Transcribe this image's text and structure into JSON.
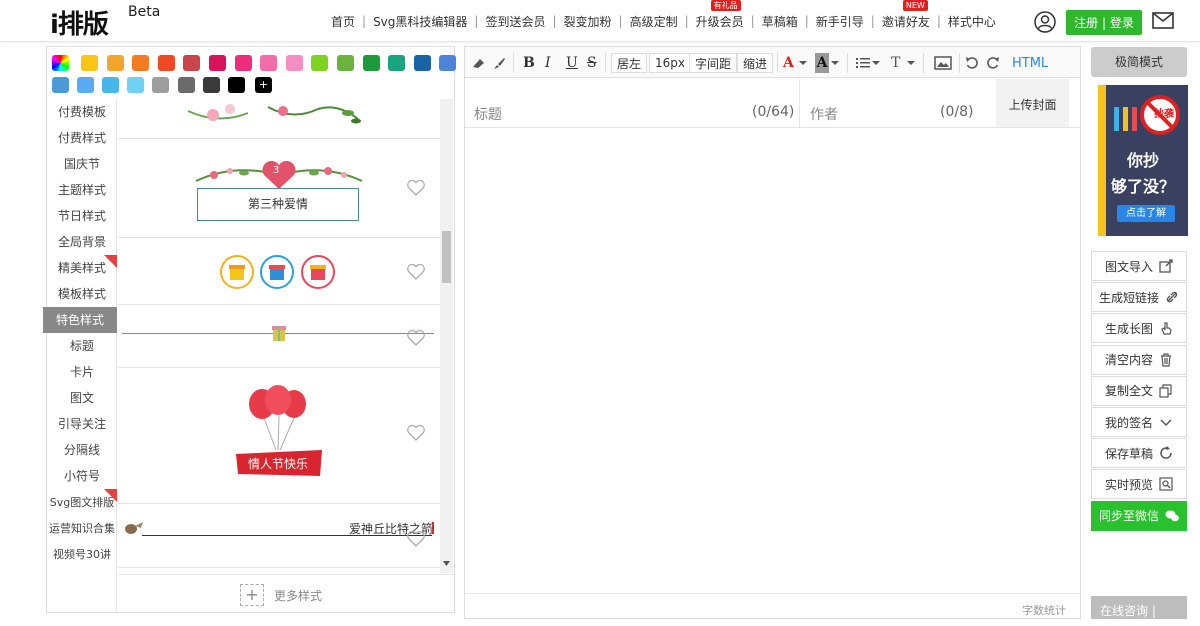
{
  "logo": {
    "main": "i排版",
    "beta": "Beta"
  },
  "nav": [
    {
      "label": "首页",
      "tag": ""
    },
    {
      "label": "Svg黑科技编辑器",
      "tag": ""
    },
    {
      "label": "签到送会员",
      "tag": ""
    },
    {
      "label": "裂变加粉",
      "tag": ""
    },
    {
      "label": "高级定制",
      "tag": ""
    },
    {
      "label": "升级会员",
      "tag": "有礼品"
    },
    {
      "label": "草稿箱",
      "tag": ""
    },
    {
      "label": "新手引导",
      "tag": ""
    },
    {
      "label": "邀请好友",
      "tag": "NEW"
    },
    {
      "label": "样式中心",
      "tag": ""
    }
  ],
  "auth": {
    "label": "注册 | 登录"
  },
  "swatches": {
    "row1": [
      "#fcc514",
      "#f3a62b",
      "#f47a23",
      "#f04a23",
      "#c8464b",
      "#d7145a",
      "#ef2d7a",
      "#f26daa",
      "#f58cc4",
      "#7ed321",
      "#6cb33e",
      "#1d9a3a",
      "#1aa37f",
      "#1864a6",
      "#4b86d8"
    ],
    "row2": [
      "#4d9ad8",
      "#5aabf1",
      "#48b6ea",
      "#6fd2f2",
      "#9e9e9e",
      "#6b6b6b",
      "#3a3a3a",
      "#000000"
    ],
    "add_symbol": "+"
  },
  "categories": [
    {
      "label": "付费模板",
      "active": false,
      "hot": false
    },
    {
      "label": "付费样式",
      "active": false,
      "hot": false
    },
    {
      "label": "国庆节",
      "active": false,
      "hot": false
    },
    {
      "label": "主题样式",
      "active": false,
      "hot": false
    },
    {
      "label": "节日样式",
      "active": false,
      "hot": false
    },
    {
      "label": "全局背景",
      "active": false,
      "hot": false
    },
    {
      "label": "精美样式",
      "active": false,
      "hot": true
    },
    {
      "label": "模板样式",
      "active": false,
      "hot": false
    },
    {
      "label": "特色样式",
      "active": true,
      "hot": false
    },
    {
      "label": "标题",
      "active": false,
      "hot": false
    },
    {
      "label": "卡片",
      "active": false,
      "hot": false
    },
    {
      "label": "图文",
      "active": false,
      "hot": false
    },
    {
      "label": "引导关注",
      "active": false,
      "hot": false
    },
    {
      "label": "分隔线",
      "active": false,
      "hot": false
    },
    {
      "label": "小符号",
      "active": false,
      "hot": false
    },
    {
      "label": "Svg图文排版",
      "active": false,
      "hot": true
    },
    {
      "label": "运营知识合集",
      "active": false,
      "hot": false
    },
    {
      "label": "视频号30讲",
      "active": false,
      "hot": false
    }
  ],
  "style_cards": {
    "card1_badge": "3",
    "card1_text": "第三种爱情",
    "card4_text": "情人节快乐",
    "card5_text": "爱神丘比特之箭"
  },
  "more_styles": "更多样式",
  "toolbar": {
    "bold": "B",
    "italic": "I",
    "underline": "U",
    "strike": "S",
    "align": "居左",
    "font_size": "16px",
    "letter_spacing": "字间距",
    "indent": "缩进",
    "font_color": "A",
    "bg_color": "A",
    "text_type": "T",
    "html": "HTML"
  },
  "title_field": {
    "placeholder": "标题",
    "counter": "(0/64)"
  },
  "author_field": {
    "placeholder": "作者",
    "counter": "(0/8)"
  },
  "cover_button": "上传封面",
  "word_count": "字数统计",
  "simple_mode": "极简模式",
  "ad": {
    "line1": "你抄",
    "line2": "够了没？",
    "button": "点击了解",
    "badge": "抄袭"
  },
  "actions": [
    {
      "label": "图文导入",
      "icon": "import-icon"
    },
    {
      "label": "生成短链接",
      "icon": "link-icon"
    },
    {
      "label": "生成长图",
      "icon": "hand-icon"
    },
    {
      "label": "清空内容",
      "icon": "trash-icon"
    },
    {
      "label": "复制全文",
      "icon": "copy-icon"
    },
    {
      "label": "我的签名",
      "icon": "chevron-down-icon"
    },
    {
      "label": "保存草稿",
      "icon": "refresh-icon"
    },
    {
      "label": "实时预览",
      "icon": "preview-icon"
    },
    {
      "label": "同步至微信",
      "icon": "wechat-icon"
    }
  ],
  "online": "在线咨询 |"
}
